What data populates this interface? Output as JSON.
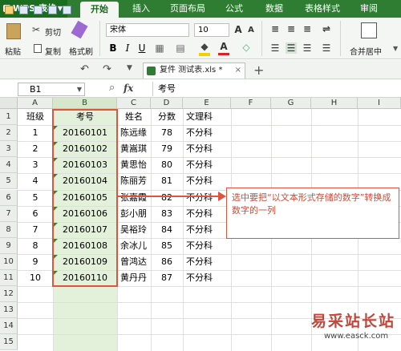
{
  "app": {
    "name": "WPS 表格"
  },
  "tabs": [
    "开始",
    "插入",
    "页面布局",
    "公式",
    "数据",
    "表格样式",
    "审阅"
  ],
  "ribbon": {
    "paste": "粘贴",
    "cut": "剪切",
    "copy": "复制",
    "format_painter": "格式刷",
    "font_name": "宋体",
    "font_size": "10",
    "merge_center": "合并居中"
  },
  "document": {
    "tab_title": "复件 测试表.xls *"
  },
  "formula_bar": {
    "name_box": "B1",
    "fx": "fx",
    "value": "考号"
  },
  "grid": {
    "columns": [
      "A",
      "B",
      "C",
      "D",
      "E",
      "F",
      "G",
      "H",
      "I"
    ],
    "selected_column": "B",
    "rows": [
      "1",
      "2",
      "3",
      "4",
      "5",
      "6",
      "7",
      "8",
      "9",
      "10",
      "11",
      "12",
      "13",
      "14",
      "15"
    ],
    "headers": {
      "A": "班级",
      "B": "考号",
      "C": "姓名",
      "D": "分数",
      "E": "文理科"
    },
    "data": [
      {
        "A": "1",
        "B": "20160101",
        "C": "陈远缘",
        "D": "78",
        "E": "不分科"
      },
      {
        "A": "2",
        "B": "20160102",
        "C": "黄嵩琪",
        "D": "79",
        "E": "不分科"
      },
      {
        "A": "3",
        "B": "20160103",
        "C": "黄思怡",
        "D": "80",
        "E": "不分科"
      },
      {
        "A": "4",
        "B": "20160104",
        "C": "陈丽芳",
        "D": "81",
        "E": "不分科"
      },
      {
        "A": "5",
        "B": "20160105",
        "C": "张嘉霞",
        "D": "82",
        "E": "不分科"
      },
      {
        "A": "6",
        "B": "20160106",
        "C": "彭小朋",
        "D": "83",
        "E": "不分科"
      },
      {
        "A": "7",
        "B": "20160107",
        "C": "吴裕玲",
        "D": "84",
        "E": "不分科"
      },
      {
        "A": "8",
        "B": "20160108",
        "C": "余冰儿",
        "D": "85",
        "E": "不分科"
      },
      {
        "A": "9",
        "B": "20160109",
        "C": "曾鸿达",
        "D": "86",
        "E": "不分科"
      },
      {
        "A": "10",
        "B": "20160110",
        "C": "黄丹丹",
        "D": "87",
        "E": "不分科"
      }
    ]
  },
  "annotation": {
    "text": "选中要把“以文本形式存储的数字”转换成数字的一列"
  },
  "watermark": {
    "text": "易采站长站",
    "url": "www.easck.com"
  },
  "colors": {
    "brand_green": "#2e7d32",
    "highlight_red": "#e0533e",
    "selected_column": "#e3f1db"
  }
}
